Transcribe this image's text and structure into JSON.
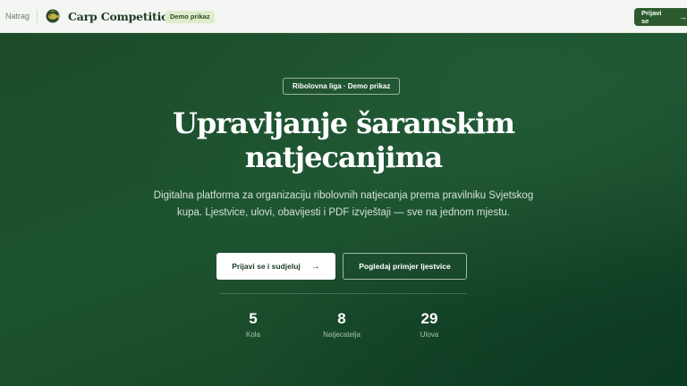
{
  "topbar": {
    "back_label": "Natrag",
    "brand": "Carp Competitions",
    "demo_badge": "Demo prikaz",
    "login_label": "Prijavi se",
    "logo_icon": "carp-fish-logo-icon"
  },
  "hero": {
    "pill": "Ribolovna liga · Demo prikaz",
    "headline_line1": "Upravljanje šaranskim",
    "headline_line2": "natjecanjima",
    "lead": "Digitalna platforma za organizaciju ribolovnih natjecanja prema pravilniku Svjetskog kupa. Ljestvice, ulovi, obavijesti i PDF izvještaji — sve na jednom mjestu.",
    "primary_cta": "Prijavi se i sudjeluj",
    "secondary_cta": "Pogledaj primjer ljestvice",
    "stats": [
      {
        "value": "5",
        "label": "Kola"
      },
      {
        "value": "8",
        "label": "Natjecatelja"
      },
      {
        "value": "29",
        "label": "Ulova"
      }
    ]
  },
  "colors": {
    "topbar_bg": "#f3f6f2",
    "brand_text": "#1e3a24",
    "accent_green": "#2c5a2e",
    "hero_green": "#1d5330",
    "badge_bg": "#dfeccb"
  }
}
